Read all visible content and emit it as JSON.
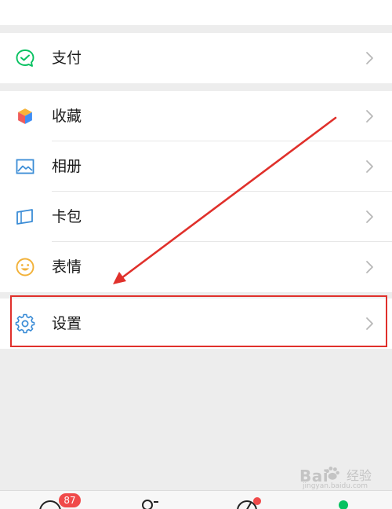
{
  "menu": {
    "pay": {
      "label": "支付",
      "icon": "wallet-check-icon"
    },
    "favorites": {
      "label": "收藏",
      "icon": "cube-icon"
    },
    "album": {
      "label": "相册",
      "icon": "image-icon"
    },
    "cards": {
      "label": "卡包",
      "icon": "card-icon"
    },
    "stickers": {
      "label": "表情",
      "icon": "smiley-icon"
    },
    "settings": {
      "label": "设置",
      "icon": "gear-icon"
    }
  },
  "tabbar": {
    "chats_badge": "87"
  },
  "watermark": {
    "text": "Bai",
    "text2": "经验",
    "url": "jingyan.baidu.com"
  },
  "colors": {
    "background": "#ededed",
    "accent_green": "#07c160",
    "highlight_red": "#e0302b",
    "badge_red": "#f04a4a"
  }
}
